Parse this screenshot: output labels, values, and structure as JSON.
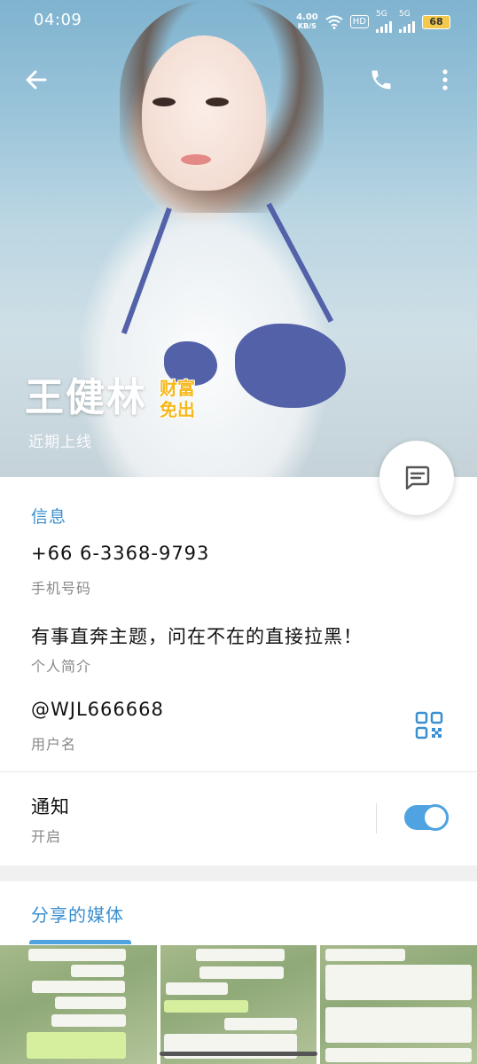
{
  "status_bar": {
    "time": "04:09",
    "net_speed_value": "4.00",
    "net_speed_unit": "KB/S",
    "hd_badge": "HD",
    "sim1_label": "5G",
    "sim2_label": "5G",
    "battery": "68"
  },
  "profile": {
    "name": "王健林",
    "sticker_line1": "财富",
    "sticker_line2": "免出",
    "last_seen": "近期上线"
  },
  "info": {
    "section_title": "信息",
    "phone_value": "+66 6-3368-9793",
    "phone_label": "手机号码",
    "bio_value": "有事直奔主题，问在不在的直接拉黑！",
    "bio_label": "个人简介",
    "username_value": "@WJL666668",
    "username_label": "用户名",
    "notify_value": "通知",
    "notify_label": "开启",
    "notifications_on": true
  },
  "media": {
    "title": "分享的媒体"
  },
  "colors": {
    "accent": "#3a8fd0",
    "toggle": "#4ea3e0",
    "battery": "#f2c94c"
  },
  "icons": {
    "back": "arrow-left-icon",
    "call": "phone-icon",
    "more": "more-vertical-icon",
    "message": "chat-bubble-icon",
    "qr": "qr-code-icon"
  }
}
